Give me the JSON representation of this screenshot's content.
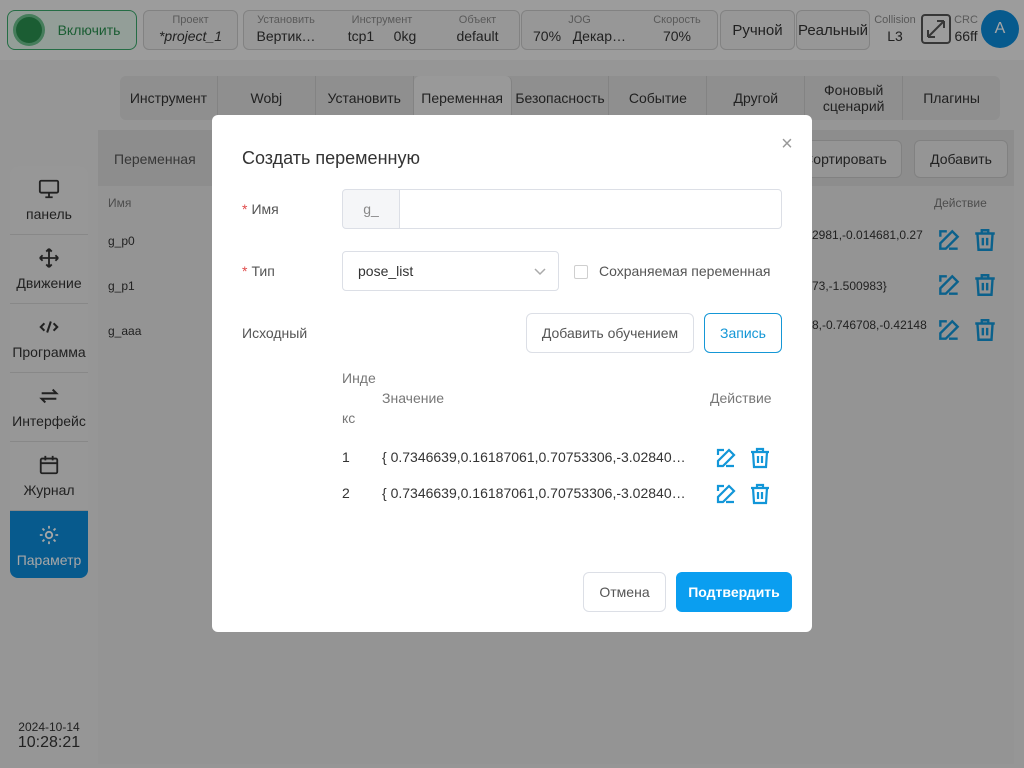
{
  "topbar": {
    "enable_label": "Включить",
    "project": {
      "caption": "Проект",
      "value": "*project_1"
    },
    "install": {
      "caption": "Установить",
      "value": "Вертик…"
    },
    "tool": {
      "caption": "Инструмент",
      "value": "tcp1",
      "value2": "0kg"
    },
    "object": {
      "caption": "Объект",
      "value": "default"
    },
    "jog": {
      "caption": "JOG",
      "value": "70%",
      "value2": "Декар…"
    },
    "speed": {
      "caption": "Скорость",
      "value": "70%"
    },
    "manual_label": "Ручной",
    "real_label": "Реальный",
    "collision": {
      "caption": "Collision",
      "value": "L3"
    },
    "crc": {
      "caption": "CRC",
      "value": "66ff"
    },
    "avatar_letter": "A"
  },
  "tabs": [
    {
      "label": "Инструмент"
    },
    {
      "label": "Wobj"
    },
    {
      "label": "Установить"
    },
    {
      "label": "Переменная"
    },
    {
      "label": "Безопасность"
    },
    {
      "label": "Событие"
    },
    {
      "label": "Другой"
    },
    {
      "label": "Фоновый сценарий"
    },
    {
      "label": "Плагины"
    }
  ],
  "panel": {
    "title": "Переменная",
    "sort_label": "Сортировать",
    "add_label": "Добавить",
    "col_name": "Имя",
    "col_action": "Действие",
    "rows": [
      {
        "name": "g_p0",
        "value": "2981,-0.014681,0.27"
      },
      {
        "name": "g_p1",
        "value": "73,-1.500983}"
      },
      {
        "name": "g_aaa",
        "value": "8,-0.746708,-0.42148"
      }
    ]
  },
  "sidebar": {
    "items": [
      {
        "label": "панель",
        "icon": "monitor-icon"
      },
      {
        "label": "Движение",
        "icon": "move-icon"
      },
      {
        "label": "Программа",
        "icon": "code-icon"
      },
      {
        "label": "Интерфейс",
        "icon": "swap-icon"
      },
      {
        "label": "Журнал",
        "icon": "calendar-icon"
      },
      {
        "label": "Параметр",
        "icon": "gear-icon"
      }
    ],
    "date": "2024-10-14",
    "time": "10:28:21"
  },
  "dialog": {
    "title": "Создать переменную",
    "name_label": "Имя",
    "name_prefix": "g_",
    "name_value": "",
    "type_label": "Тип",
    "type_value": "pose_list",
    "persist_label": "Сохраняемая переменная",
    "initial_label": "Исходный",
    "teach_label": "Добавить обучением",
    "record_label": "Запись",
    "table": {
      "col_index_a": "Инде",
      "col_index_b": "кс",
      "col_value": "Значение",
      "col_action": "Действие",
      "rows": [
        {
          "index": "1",
          "value": "{ 0.7346639,0.16187061,0.70753306,-3.02840…"
        },
        {
          "index": "2",
          "value": "{ 0.7346639,0.16187061,0.70753306,-3.02840…"
        }
      ]
    },
    "cancel_label": "Отмена",
    "confirm_label": "Подтвердить"
  },
  "colors": {
    "accent": "#0b8ad9",
    "primary_button": "#0a9ef0",
    "enable_green": "#2a8f4f"
  }
}
